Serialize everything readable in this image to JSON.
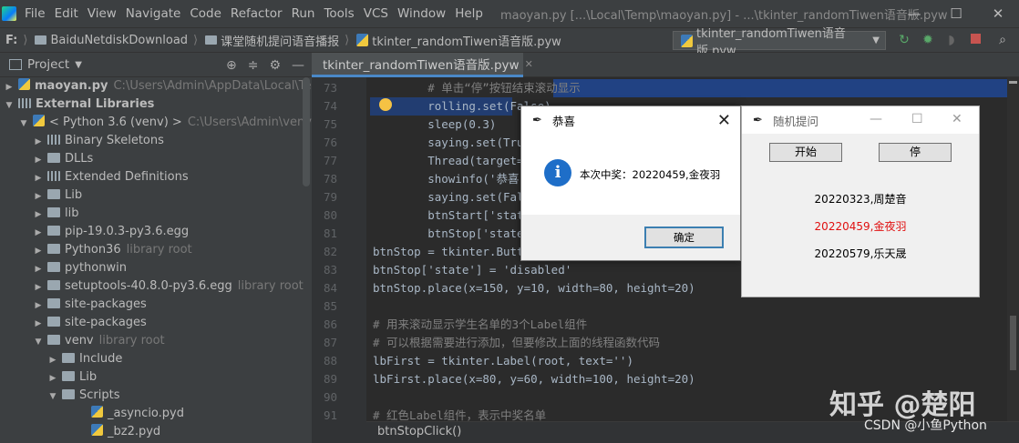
{
  "menubar": {
    "items": [
      "File",
      "Edit",
      "View",
      "Navigate",
      "Code",
      "Refactor",
      "Run",
      "Tools",
      "VCS",
      "Window",
      "Help"
    ],
    "window_title": "maoyan.py [...\\Local\\Temp\\maoyan.py] - ...\\tkinter_randomTiwen语音版.pyw",
    "controls": [
      "—",
      "☐",
      "✕"
    ]
  },
  "navbar": {
    "drive": "F:",
    "crumbs": [
      "BaiduNetdiskDownload",
      "课堂随机提问语音播报",
      "tkinter_randomTiwen语音版.pyw"
    ],
    "run_config": "tkinter_randomTiwen语音版.pyw"
  },
  "project": {
    "title": "Project",
    "tree": [
      {
        "label": "maoyan.py",
        "hint": "C:\\Users\\Admin\\AppData\\Local\\Temp\\",
        "arrow": "▶",
        "icon": "py"
      },
      {
        "label": "External Libraries",
        "hint": "",
        "arrow": "▼",
        "icon": "lib"
      },
      {
        "label": "< Python 3.6 (venv) >",
        "hint": "C:\\Users\\Admin\\venv\\Scrip",
        "arrow": "▼",
        "icon": "py"
      },
      {
        "label": "Binary Skeletons",
        "hint": "",
        "arrow": "▶",
        "icon": "lib"
      },
      {
        "label": "DLLs",
        "hint": "",
        "arrow": "▶",
        "icon": "folder"
      },
      {
        "label": "Extended Definitions",
        "hint": "",
        "arrow": "▶",
        "icon": "lib"
      },
      {
        "label": "Lib",
        "hint": "",
        "arrow": "▶",
        "icon": "folder"
      },
      {
        "label": "lib",
        "hint": "",
        "arrow": "▶",
        "icon": "folder"
      },
      {
        "label": "pip-19.0.3-py3.6.egg",
        "hint": "",
        "arrow": "▶",
        "icon": "folder"
      },
      {
        "label": "Python36",
        "hint": "library root",
        "arrow": "▶",
        "icon": "folder"
      },
      {
        "label": "pythonwin",
        "hint": "",
        "arrow": "▶",
        "icon": "folder"
      },
      {
        "label": "setuptools-40.8.0-py3.6.egg",
        "hint": "library root",
        "arrow": "▶",
        "icon": "folder"
      },
      {
        "label": "site-packages",
        "hint": "",
        "arrow": "▶",
        "icon": "folder"
      },
      {
        "label": "site-packages",
        "hint": "",
        "arrow": "▶",
        "icon": "folder"
      },
      {
        "label": "venv",
        "hint": "library root",
        "arrow": "▼",
        "icon": "folder"
      },
      {
        "label": "Include",
        "hint": "",
        "arrow": "▶",
        "icon": "folder"
      },
      {
        "label": "Lib",
        "hint": "",
        "arrow": "▶",
        "icon": "folder"
      },
      {
        "label": "Scripts",
        "hint": "",
        "arrow": "▼",
        "icon": "folder"
      },
      {
        "label": "_asyncio.pyd",
        "hint": "",
        "arrow": "",
        "icon": "py"
      },
      {
        "label": "_bz2.pyd",
        "hint": "",
        "arrow": "",
        "icon": "py"
      }
    ]
  },
  "editor": {
    "tab_label": "tkinter_randomTiwen语音版.pyw",
    "line_numbers": [
      "73",
      "74",
      "75",
      "76",
      "77",
      "78",
      "79",
      "80",
      "81",
      "82",
      "83",
      "84",
      "85",
      "86",
      "87",
      "88",
      "89",
      "90",
      "91"
    ],
    "code_lines": [
      "        # 单击“停”按钮结束滚动显示",
      "        rolling.set(False)",
      "        sleep(0.3)",
      "        saying.set(True)",
      "        Thread(target=say_n",
      "        showinfo('恭喜', '本",
      "        saying.set(False)",
      "        btnStart['state'] =",
      "        btnStop['state'] =",
      "btnStop = tkinter.Butto",
      "btnStop['state'] = 'disabled'",
      "btnStop.place(x=150, y=10, width=80, height=20)",
      "",
      "# 用来滚动显示学生名单的3个Label组件",
      "# 可以根据需要进行添加，但要修改上面的线程函数代码",
      "lbFirst = tkinter.Label(root, text='')",
      "lbFirst.place(x=80, y=60, width=100, height=20)",
      "",
      "# 红色Label组件，表示中奖名单"
    ],
    "bottom_breadcrumb": "btnStopClick()"
  },
  "dialog_congrats": {
    "title": "恭喜",
    "message": "本次中奖：20220459,金夜羽",
    "ok_label": "确定",
    "info_glyph": "i"
  },
  "dialog_random": {
    "title": "随机提问",
    "start_label": "开始",
    "stop_label": "停",
    "names": [
      "20220323,周楚音",
      "20220459,金夜羽",
      "20220579,乐天晟"
    ],
    "highlight_color": "#e01010"
  },
  "watermark": {
    "zhihu": "知乎 @楚阳",
    "csdn": "CSDN @小鱼Python"
  }
}
